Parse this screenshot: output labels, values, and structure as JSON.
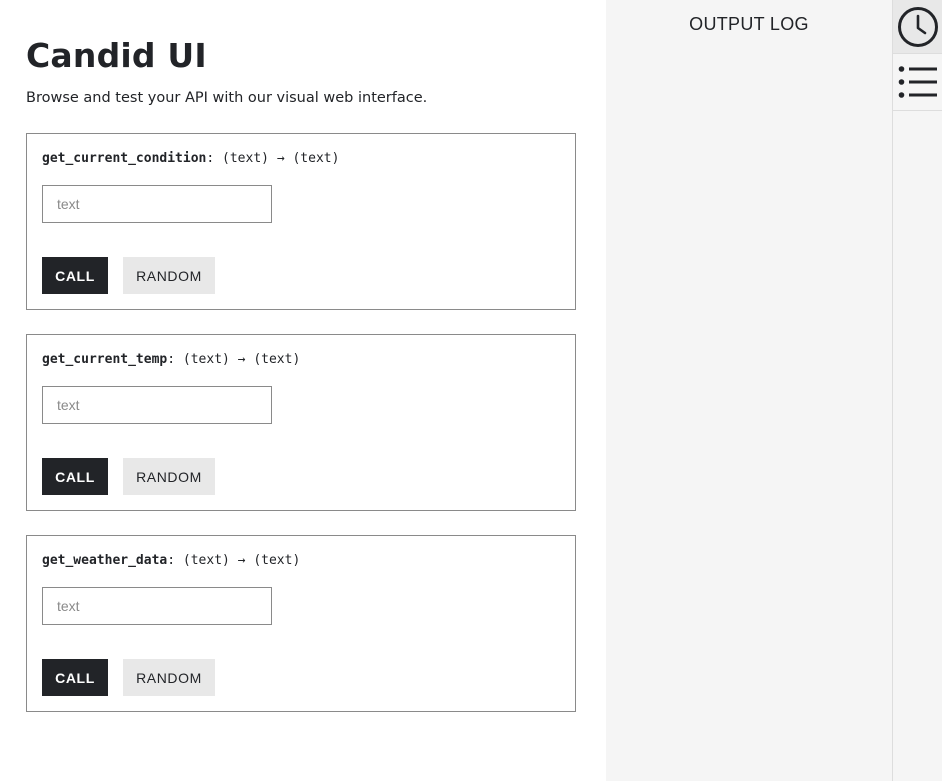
{
  "header": {
    "title": "Candid UI",
    "subtitle": "Browse and test your API with our visual web interface."
  },
  "methods": [
    {
      "name": "get_current_condition",
      "signature_rest": ": (text) → (text)",
      "input_placeholder": "text",
      "input_value": "",
      "call_label": "CALL",
      "random_label": "RANDOM"
    },
    {
      "name": "get_current_temp",
      "signature_rest": ": (text) → (text)",
      "input_placeholder": "text",
      "input_value": "",
      "call_label": "CALL",
      "random_label": "RANDOM"
    },
    {
      "name": "get_weather_data",
      "signature_rest": ": (text) → (text)",
      "input_placeholder": "text",
      "input_value": "",
      "call_label": "CALL",
      "random_label": "RANDOM"
    }
  ],
  "output_panel": {
    "title": "OUTPUT LOG"
  },
  "rail": {
    "items": [
      {
        "icon": "clock-icon",
        "active": true
      },
      {
        "icon": "list-icon",
        "active": false
      }
    ]
  },
  "colors": {
    "primary_button": "#222428",
    "secondary_button": "#e8e8e8",
    "panel_background": "#f5f5f5",
    "border": "#8a8a8a"
  }
}
